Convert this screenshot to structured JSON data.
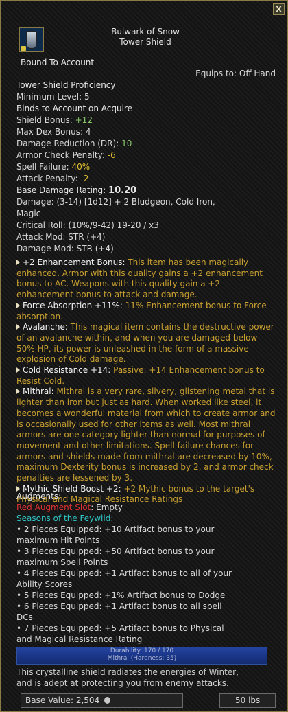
{
  "close_label": "X",
  "title_line1": "Bulwark of Snow",
  "title_line2": "Tower Shield",
  "bound": "Bound To Account",
  "equips": "Equips to: Off Hand",
  "proficiency": "Tower Shield Proficiency",
  "min_level": "Minimum Level: 5",
  "binds": "Binds to Account on Acquire",
  "shield_bonus_label": "Shield Bonus:",
  "shield_bonus_value": "+12",
  "max_dex": "Max Dex Bonus: 4",
  "dr_label": "Damage Reduction (DR):",
  "dr_value": "10",
  "acp_label": "Armor Check Penalty:",
  "acp_value": "-6",
  "sf_label": "Spell Failure:",
  "sf_value": "40%",
  "ap_label": "Attack Penalty:",
  "ap_value": "-2",
  "bdr_label": "Base Damage Rating:",
  "bdr_value": "10.20",
  "damage_1": "Damage: (3-14) [1d12] + 2 Bludgeon, Cold Iron,",
  "damage_2": "Magic",
  "crit": "Critical Roll: (10%/9-42) 19-20 / x3",
  "attack_mod": "Attack Mod: STR (+4)",
  "damage_mod": "Damage Mod: STR (+4)",
  "enchants": [
    {
      "name": "+2 Enhancement Bonus:",
      "desc": " This item has been magically enhanced. Armor with this quality gains a +2 enhancement bonus to AC. Weapons with this quality gain a +2 enhancement bonus to attack and damage."
    },
    {
      "name": "Force Absorption +11%:",
      "desc": " 11% Enhancement bonus to Force absorption."
    },
    {
      "name": "Avalanche:",
      "desc": " This magical item contains the destructive power of an avalanche within, and when you are damaged below 50% HP, its power is unleashed in the form of a massive explosion of Cold damage."
    },
    {
      "name": "Cold Resistance +14:",
      "desc": " Passive: +14 Enhancement bonus to Resist Cold."
    },
    {
      "name": "Mithral:",
      "desc": " Mithral is a very rare, silvery, glistening metal that is lighter than iron but just as hard. When worked like steel, it becomes a wonderful material from which to create armor and is occasionally used for other items as well. Most mithral armors are one category lighter than normal for purposes of movement and other limitations. Spell failure chances for armors and shields made from mithral are decreased by 10%, maximum Dexterity bonus is increased by 2, and armor check penalties are lessened by 3."
    },
    {
      "name": "Mythic Shield Boost +2:",
      "desc": " +2 Mythic bonus to the target's Physical and Magical Resistance Ratings"
    }
  ],
  "augments_label": "Augments:",
  "augment_slot_label": "Red Augment Slot",
  "augment_slot_value": ": Empty",
  "set_name": "Seasons of the Feywild:",
  "set_bonuses": [
    [
      "• 2 Pieces Equipped: +10 Artifact bonus to your",
      "maximum Hit Points"
    ],
    [
      "• 3 Pieces Equipped: +50 Artifact bonus to your",
      "maximum Spell Points"
    ],
    [
      "• 4 Pieces Equipped: +1 Artifact bonus to all of your",
      "Ability Scores"
    ],
    [
      "• 5 Pieces Equipped: +1% Artifact bonus to Dodge"
    ],
    [
      "• 6 Pieces Equipped: +1 Artifact bonus to all spell",
      "DCs"
    ],
    [
      "• 7 Pieces Equipped: +5 Artifact bonus to Physical",
      "and Magical Resistance Rating"
    ]
  ],
  "durability": "Durability: 170 / 170",
  "material": "Mithral (Hardness: 35)",
  "description_1": "This crystalline shield radiates the energies of Winter,",
  "description_2": "and is adept at protecting you from enemy attacks.",
  "base_value": "Base Value: 2,504",
  "weight": "50 lbs",
  "colors": {
    "border": "#8a7a44",
    "positive": "#8ac86a",
    "negative": "#e0c030",
    "augment": "#e03030",
    "set": "#30c8c8",
    "enchant_desc": "#c8a030"
  },
  "icons": [
    "shield-item-icon",
    "lock-icon",
    "coin-icon",
    "triangle-bullet-icon"
  ]
}
